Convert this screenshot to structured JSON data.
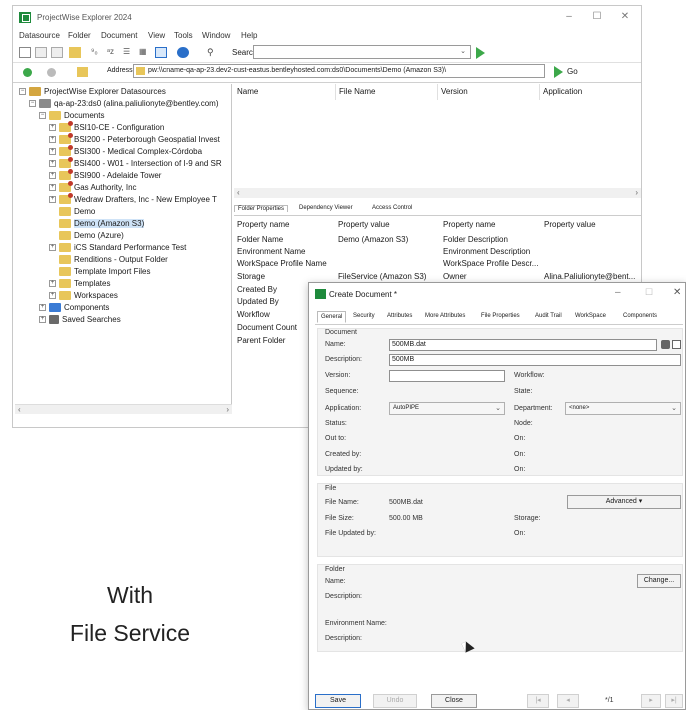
{
  "app": {
    "title": "ProjectWise Explorer 2024"
  },
  "menu": [
    "Datasource",
    "Folder",
    "Document",
    "View",
    "Tools",
    "Window",
    "Help"
  ],
  "toolbar": {
    "search_label": "Search"
  },
  "addressbar": {
    "label": "Address",
    "value": "pw:\\\\cname-qa-ap-23.dev2-cust-eastus.bentleyhosted.com:ds0\\Documents\\Demo (Amazon S3)\\",
    "go_label": "Go"
  },
  "tree": {
    "root": "ProjectWise Explorer Datasources",
    "datasource": "qa-ap-23:ds0 (alina.paliulionyte@bentley.com)",
    "documents": "Documents",
    "items": [
      "BSI10-CE - Configuration",
      "BSI200 - Peterborough Geospatial Invest",
      "BSI300 - Medical Complex-Córdoba",
      "BSI400 - W01 - Intersection of I-9 and SR",
      "BSI900 - Adelaide Tower",
      "Gas Authority, Inc",
      "Wedraw Drafters, Inc - New Employee T",
      "Demo",
      "Demo (Amazon S3)",
      "Demo (Azure)",
      "iCS Standard Performance Test",
      "Renditions - Output Folder",
      "Template Import Files",
      "Templates",
      "Workspaces"
    ],
    "components": "Components",
    "saved_searches": "Saved Searches"
  },
  "list": {
    "columns": [
      "Name",
      "File Name",
      "Version",
      "Application"
    ]
  },
  "properties": {
    "tabs": [
      "Folder Properties",
      "Dependency Viewer",
      "Access Control"
    ],
    "headers": [
      "Property name",
      "Property value",
      "Property name",
      "Property value"
    ],
    "left": [
      {
        "name": "Folder Name",
        "value": "Demo (Amazon S3)"
      },
      {
        "name": "Environment Name",
        "value": ""
      },
      {
        "name": "WorkSpace Profile Name",
        "value": ""
      },
      {
        "name": "Storage",
        "value": "FileService (Amazon S3)"
      },
      {
        "name": "Created By",
        "value": ""
      },
      {
        "name": "Updated By",
        "value": ""
      },
      {
        "name": "Workflow",
        "value": ""
      },
      {
        "name": "Document Count",
        "value": ""
      },
      {
        "name": "Parent Folder",
        "value": ""
      }
    ],
    "right": [
      {
        "name": "Folder Description",
        "value": ""
      },
      {
        "name": "Environment Description",
        "value": ""
      },
      {
        "name": "WorkSpace Profile Descr...",
        "value": ""
      },
      {
        "name": "Owner",
        "value": "Alina.Paliulionyte@bent..."
      }
    ]
  },
  "dialog": {
    "title": "Create Document *",
    "tabs": [
      "General",
      "Security",
      "Attributes",
      "More Attributes",
      "File Properties",
      "Audit Trail",
      "WorkSpace",
      "Components"
    ],
    "document_group": "Document",
    "name_label": "Name:",
    "name_value": "500MB.dat",
    "description_label": "Description:",
    "description_value": "500MB",
    "version_label": "Version:",
    "workflow_label": "Workflow:",
    "sequence_label": "Sequence:",
    "state_label": "State:",
    "application_label": "Application:",
    "application_value": "AutoPIPE",
    "department_label": "Department:",
    "department_value": "<none>",
    "status_label": "Status:",
    "node_label": "Node:",
    "outto_label": "Out to:",
    "on_label": "On:",
    "createdby_label": "Created by:",
    "updatedby_label": "Updated by:",
    "file_group": "File",
    "filename_label": "File Name:",
    "filename_value": "500MB.dat",
    "filesize_label": "File Size:",
    "filesize_value": "500.00 MB",
    "storage_label": "Storage:",
    "fileupdatedby_label": "File Updated by:",
    "advanced_button": "Advanced",
    "folder_group": "Folder",
    "folder_name_label": "Name:",
    "folder_description_label": "Description:",
    "change_button": "Change...",
    "env_name_label": "Environment Name:",
    "env_description_label": "Description:",
    "save_button": "Save",
    "undo_button": "Undo",
    "close_button": "Close",
    "pager": "*/1"
  },
  "caption": {
    "line1": "With",
    "line2": "File Service"
  },
  "colors": {
    "accent": "#1e8a3c",
    "selection": "#cfe3f7",
    "folder": "#e8c65a"
  }
}
